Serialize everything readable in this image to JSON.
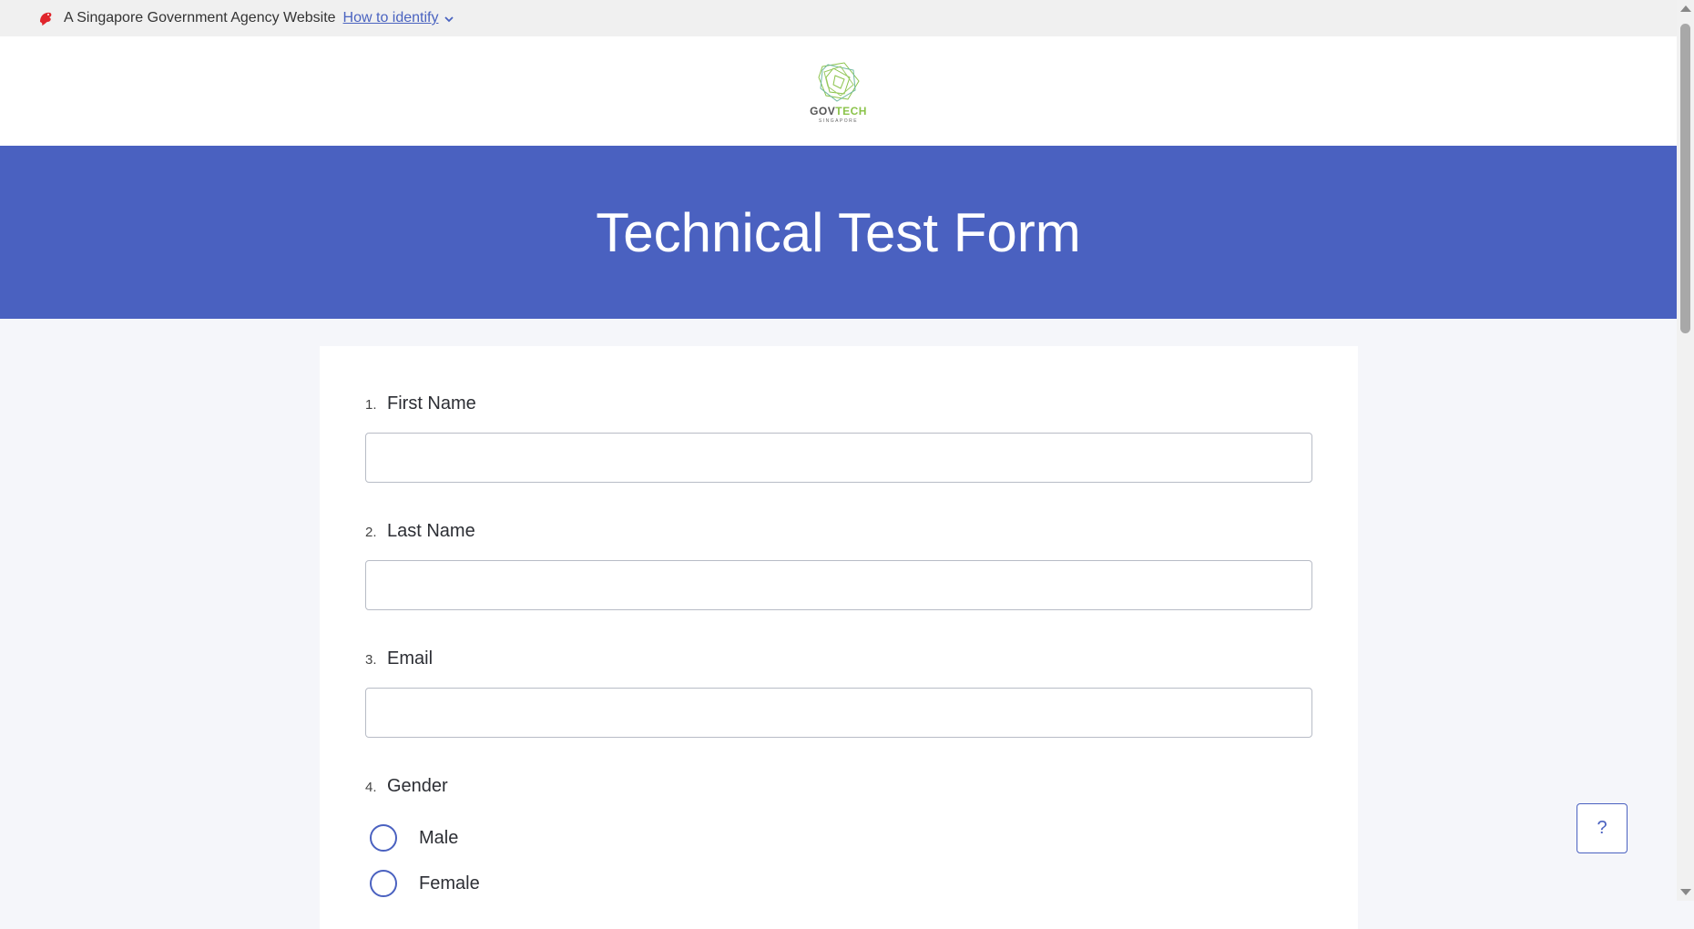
{
  "masthead": {
    "agency_text": "A Singapore Government Agency Website",
    "identify_link": "How to identify"
  },
  "logo": {
    "gov": "GOV",
    "tech": "TECH",
    "sub": "SINGAPORE"
  },
  "banner": {
    "title": "Technical Test Form"
  },
  "form": {
    "questions": [
      {
        "number": "1.",
        "label": "First Name",
        "value": ""
      },
      {
        "number": "2.",
        "label": "Last Name",
        "value": ""
      },
      {
        "number": "3.",
        "label": "Email",
        "value": ""
      },
      {
        "number": "4.",
        "label": "Gender",
        "options": [
          "Male",
          "Female"
        ]
      }
    ]
  },
  "help": {
    "label": "?"
  },
  "colors": {
    "brand": "#4a61c0",
    "masthead_bg": "#f0f0f0",
    "page_bg": "#f5f6fa",
    "lion_red": "#e0252b",
    "logo_green": "#8bc34a"
  }
}
